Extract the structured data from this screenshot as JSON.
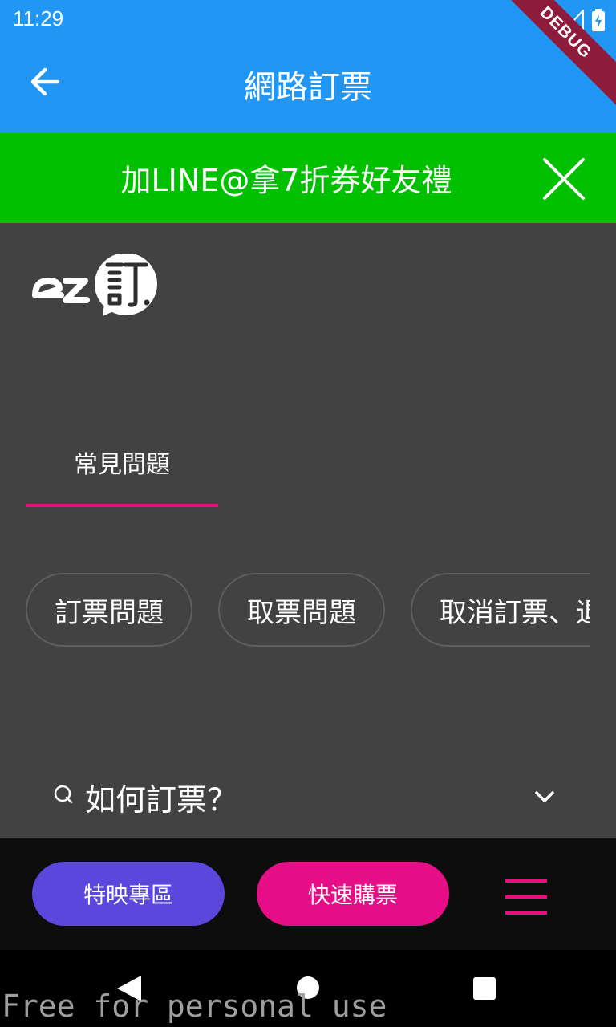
{
  "status_bar": {
    "time": "11:29"
  },
  "debug_banner": "DEBUG",
  "app_bar": {
    "title": "網路訂票"
  },
  "promo": {
    "text": "加LINE@拿7折券好友禮"
  },
  "tab": {
    "label": "常見問題"
  },
  "chips": [
    "訂票問題",
    "取票問題",
    "取消訂票、退票"
  ],
  "question": {
    "text": "如何訂票？"
  },
  "bottom_bar": {
    "premiere_label": "特映專區",
    "quick_buy_label": "快速購票"
  },
  "watermark": "Free for personal use",
  "colors": {
    "app_bar": "#2196F3",
    "promo": "#00C000",
    "accent": "#E8117F",
    "premiere": "#5B47DB",
    "background": "#424242"
  },
  "icons": {
    "back": "arrow-back-icon",
    "close": "close-icon",
    "chevron": "chevron-down-icon",
    "menu": "hamburger-icon",
    "search": "search-icon"
  }
}
